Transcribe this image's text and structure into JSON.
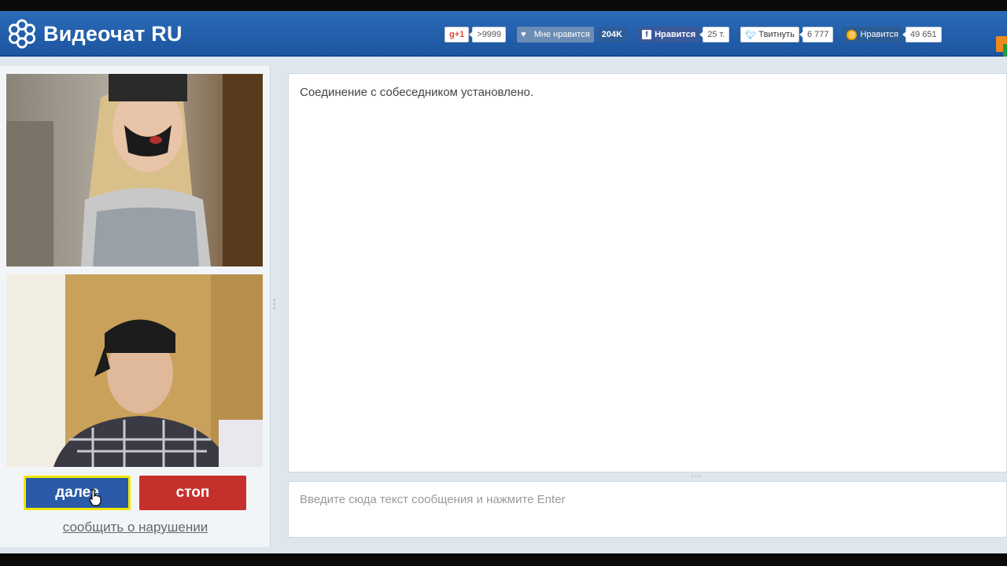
{
  "app": {
    "title": "Видеочат RU"
  },
  "social": {
    "gplus_label": "g+1",
    "gplus_count": ">9999",
    "like_label": "Мне нравится",
    "like_count": "204K",
    "fb_label": "Нравится",
    "fb_count": "25 т.",
    "tw_label": "Твитнуть",
    "tw_count": "6 777",
    "ok_label": "Нравится",
    "ok_count": "49 651"
  },
  "controls": {
    "next_label": "далее",
    "stop_label": "стоп",
    "report_label": "сообщить о нарушении"
  },
  "chat": {
    "messages": [
      "Соединение с собеседником установлено."
    ],
    "input_placeholder": "Введите сюда текст сообщения и нажмите Enter"
  },
  "colors": {
    "header": "#1d55a0",
    "next_button": "#2a5aa8",
    "next_highlight": "#f2e600",
    "stop_button": "#c6302c"
  },
  "icons": [
    "logo-flower-icon",
    "heart-icon",
    "facebook-icon",
    "twitter-icon",
    "odnoklassniki-icon",
    "hand-cursor-icon"
  ]
}
